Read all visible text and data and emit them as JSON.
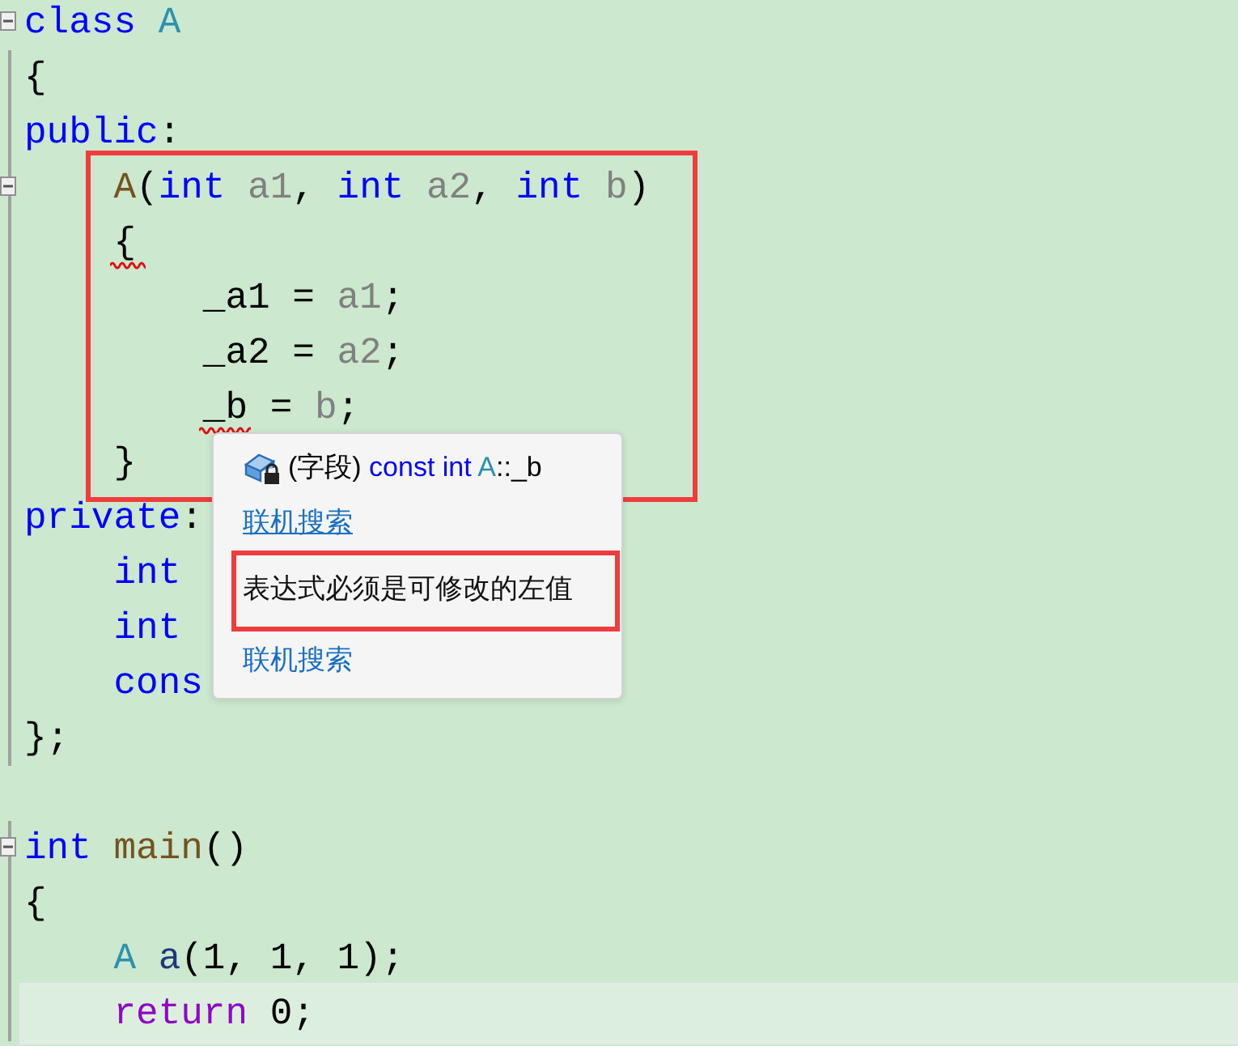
{
  "editor": {
    "lines": [
      {
        "foldable": true,
        "tokens": [
          {
            "text": "class",
            "kind": "keyword"
          },
          {
            "text": " A",
            "kind": "type"
          }
        ]
      },
      {
        "tokens": [
          {
            "text": "{",
            "kind": "plain"
          }
        ]
      },
      {
        "tokens": [
          {
            "text": "public",
            "kind": "keyword"
          },
          {
            "text": ":",
            "kind": "plain"
          }
        ]
      },
      {
        "kind": "group",
        "boxed": true,
        "lines": [
          {
            "foldable": true,
            "tokens": [
              {
                "text": "    A",
                "kind": "function"
              },
              {
                "text": "(",
                "kind": "plain"
              },
              {
                "text": "int",
                "kind": "keyword"
              },
              {
                "text": " a1",
                "kind": "param"
              },
              {
                "text": ", ",
                "kind": "plain"
              },
              {
                "text": "int",
                "kind": "keyword"
              },
              {
                "text": " a2",
                "kind": "param"
              },
              {
                "text": ", ",
                "kind": "plain"
              },
              {
                "text": "int",
                "kind": "keyword"
              },
              {
                "text": " b",
                "kind": "param"
              },
              {
                "text": ")",
                "kind": "plain"
              }
            ]
          },
          {
            "tokens": [
              {
                "text": "    {",
                "kind": "plain",
                "error": true
              }
            ]
          },
          {
            "tokens": [
              {
                "text": "        _a1 = ",
                "kind": "plain"
              },
              {
                "text": "a1",
                "kind": "param"
              },
              {
                "text": ";",
                "kind": "plain"
              }
            ]
          },
          {
            "tokens": [
              {
                "text": "        _a2 = ",
                "kind": "plain"
              },
              {
                "text": "a2",
                "kind": "param"
              },
              {
                "text": ";",
                "kind": "plain"
              }
            ]
          },
          {
            "tokens": [
              {
                "text": "        _b",
                "kind": "plain",
                "error": true
              },
              {
                "text": " = ",
                "kind": "plain"
              },
              {
                "text": "b",
                "kind": "param"
              },
              {
                "text": ";",
                "kind": "plain"
              }
            ]
          },
          {
            "tokens": [
              {
                "text": "    }",
                "kind": "plain"
              }
            ]
          }
        ]
      },
      {
        "tokens": [
          {
            "text": "private",
            "kind": "keyword"
          },
          {
            "text": ":",
            "kind": "plain"
          }
        ]
      },
      {
        "tokens": [
          {
            "text": "    int",
            "kind": "keyword"
          }
        ]
      },
      {
        "tokens": [
          {
            "text": "    int",
            "kind": "keyword"
          }
        ]
      },
      {
        "tokens": [
          {
            "text": "    cons",
            "kind": "keyword"
          }
        ]
      },
      {
        "tokens": [
          {
            "text": "};",
            "kind": "plain"
          }
        ]
      },
      {
        "kind": "blank"
      },
      {
        "foldable": true,
        "tokens": [
          {
            "text": "int",
            "kind": "keyword"
          },
          {
            "text": " main",
            "kind": "function"
          },
          {
            "text": "()",
            "kind": "plain"
          }
        ]
      },
      {
        "tokens": [
          {
            "text": "{",
            "kind": "plain"
          }
        ]
      },
      {
        "tokens": [
          {
            "text": "    A",
            "kind": "type"
          },
          {
            "text": " a",
            "kind": "local"
          },
          {
            "text": "(1, 1, 1);",
            "kind": "plain"
          }
        ]
      },
      {
        "current": true,
        "tokens": [
          {
            "text": "    return",
            "kind": "control"
          },
          {
            "text": " 0;",
            "kind": "plain"
          }
        ]
      }
    ]
  },
  "tooltip": {
    "signature": [
      {
        "text": "(字段) ",
        "kind": "plain"
      },
      {
        "text": "const int ",
        "kind": "keyword"
      },
      {
        "text": "A",
        "kind": "type"
      },
      {
        "text": "::_b",
        "kind": "plain"
      }
    ],
    "items": [
      {
        "kind": "link",
        "text": "联机搜索",
        "focused": true
      },
      {
        "kind": "message",
        "text": "表达式必须是可修改的左值",
        "highlighted": true
      },
      {
        "kind": "link",
        "text": "联机搜索",
        "focused": false
      }
    ]
  }
}
